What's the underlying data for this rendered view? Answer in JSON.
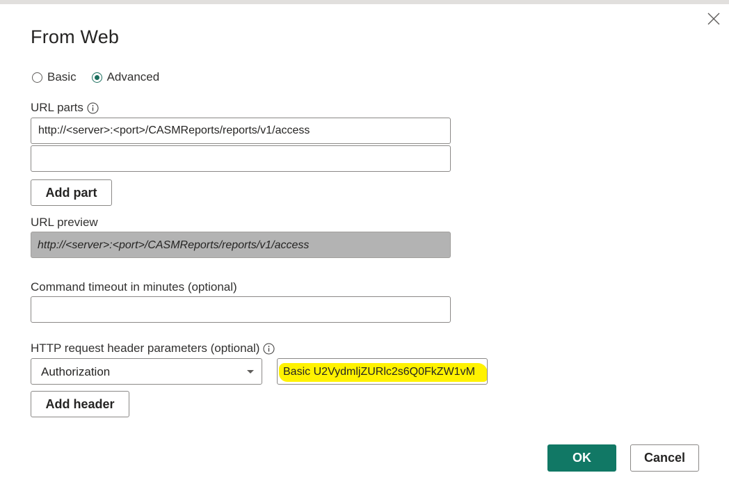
{
  "dialog": {
    "title": "From Web",
    "close_icon": "close-icon"
  },
  "mode": {
    "options": [
      {
        "label": "Basic",
        "selected": false
      },
      {
        "label": "Advanced",
        "selected": true
      }
    ]
  },
  "url_parts": {
    "label": "URL parts",
    "info_icon": "info-icon",
    "parts": [
      "http://<server>:<port>/CASMReports/reports/v1/access",
      ""
    ],
    "add_part_label": "Add part"
  },
  "url_preview": {
    "label": "URL preview",
    "value": "http://<server>:<port>/CASMReports/reports/v1/access"
  },
  "timeout": {
    "label": "Command timeout in minutes (optional)",
    "value": ""
  },
  "headers": {
    "label": "HTTP request header parameters (optional)",
    "info_icon": "info-icon",
    "name_selected": "Authorization",
    "value": "Basic U2VydmljZURlc2s6Q0FkZW1vM",
    "highlight_color": "#fff200",
    "add_header_label": "Add header"
  },
  "footer": {
    "ok_label": "OK",
    "cancel_label": "Cancel",
    "ok_color": "#117865"
  }
}
